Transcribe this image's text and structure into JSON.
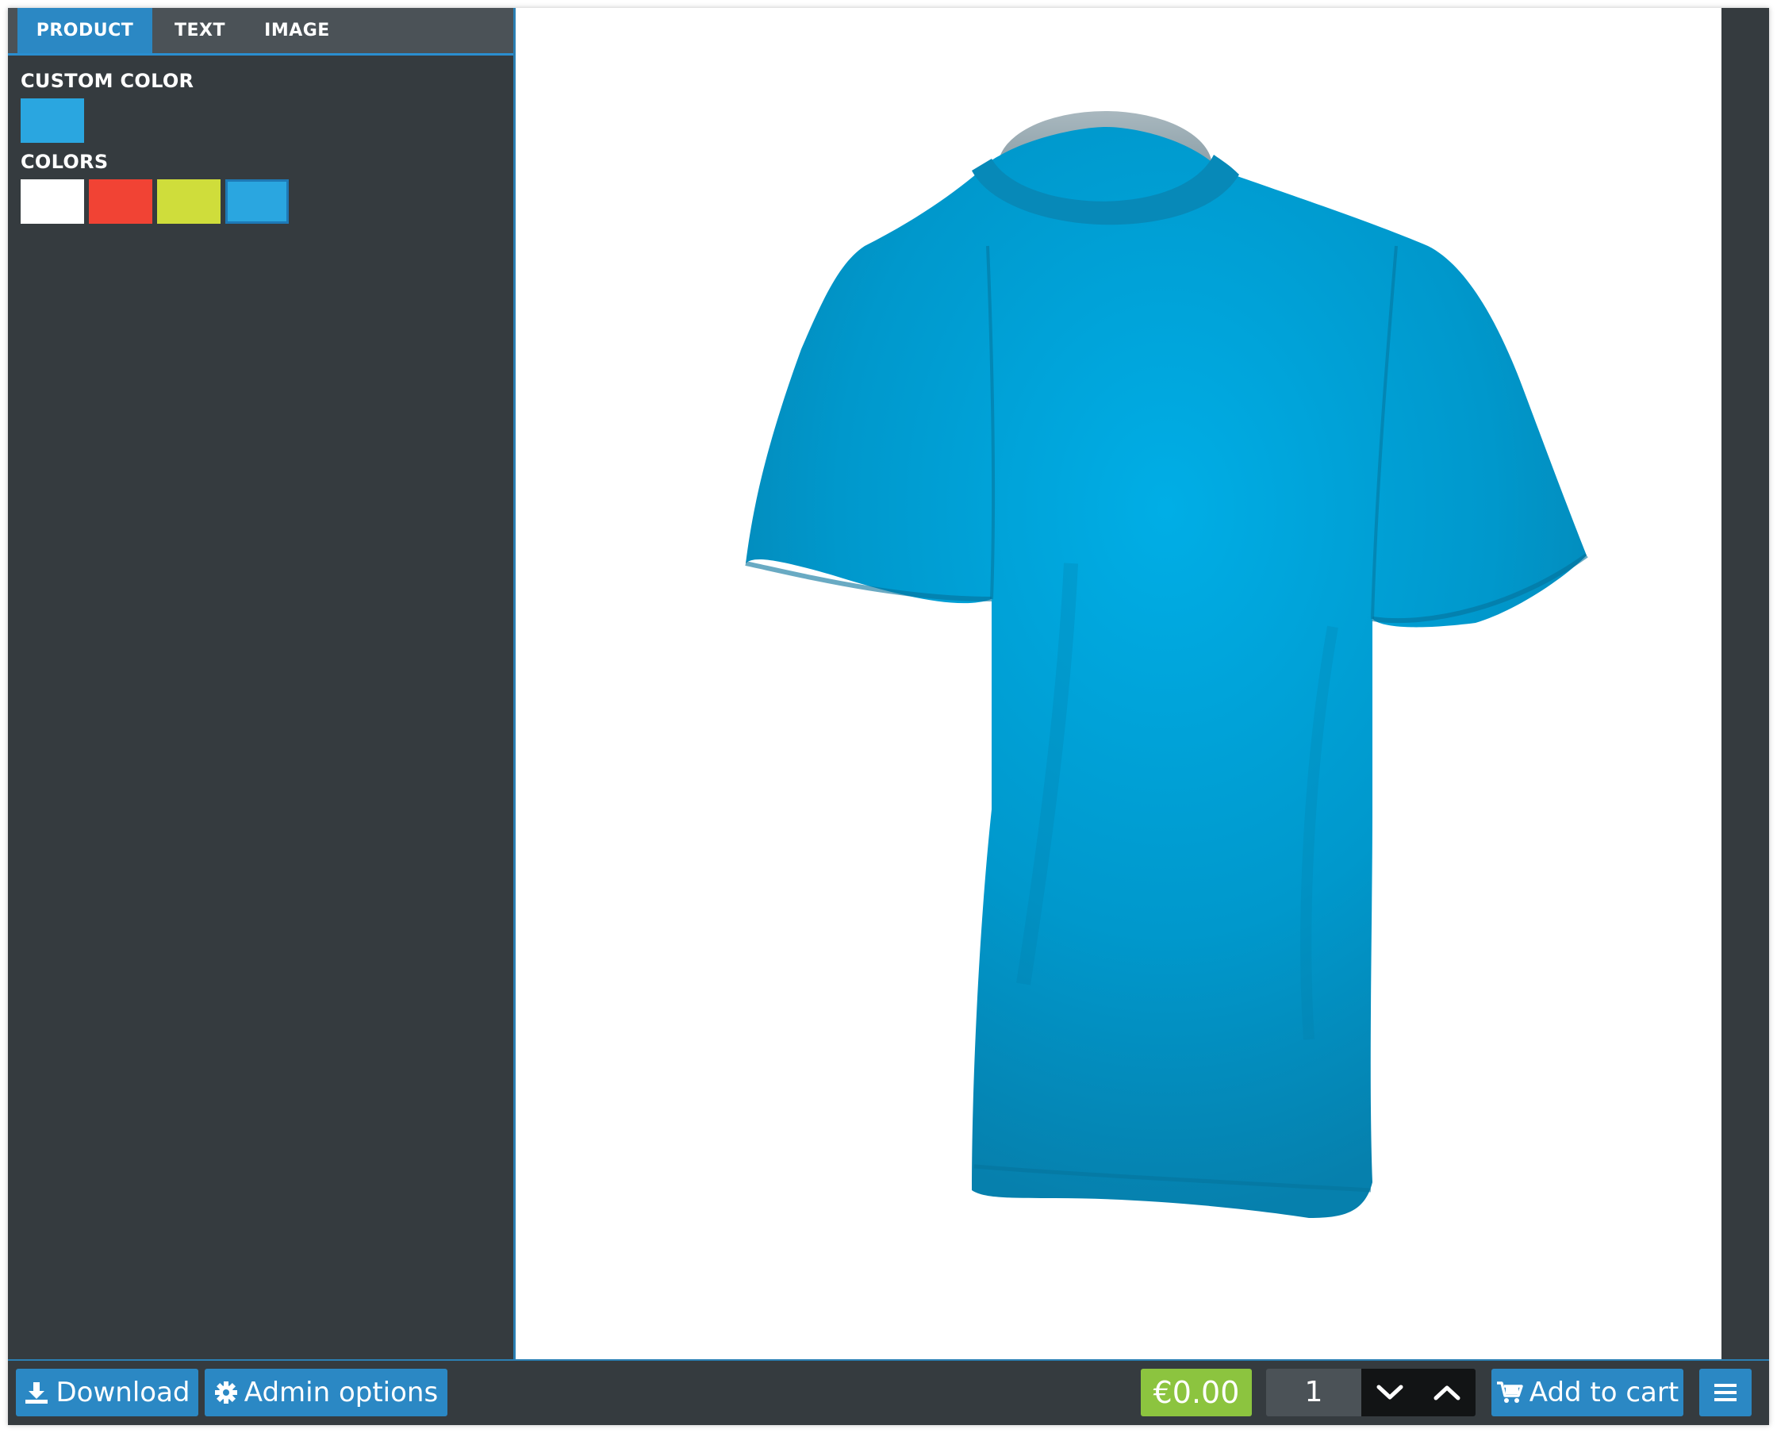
{
  "tabs": [
    {
      "label": "PRODUCT",
      "active": true
    },
    {
      "label": "TEXT",
      "active": false
    },
    {
      "label": "IMAGE",
      "active": false
    }
  ],
  "custom_color": {
    "label": "CUSTOM COLOR",
    "value": "#2aa6e0"
  },
  "colors": {
    "label": "COLORS",
    "swatches": [
      "#ffffff",
      "#f14334",
      "#cfdd3b",
      "#2aa6e0"
    ],
    "selected_index": 3
  },
  "product": {
    "color": "#0096c8"
  },
  "bottombar": {
    "download_label": "Download",
    "admin_label": "Admin options",
    "price": "€0.00",
    "quantity": "1",
    "add_to_cart_label": "Add to cart"
  },
  "icons": {
    "download": "download-icon",
    "admin": "gear-icon",
    "qty_down": "chevron-down-icon",
    "qty_up": "chevron-up-icon",
    "cart": "cart-icon",
    "menu": "hamburger-menu-icon"
  }
}
